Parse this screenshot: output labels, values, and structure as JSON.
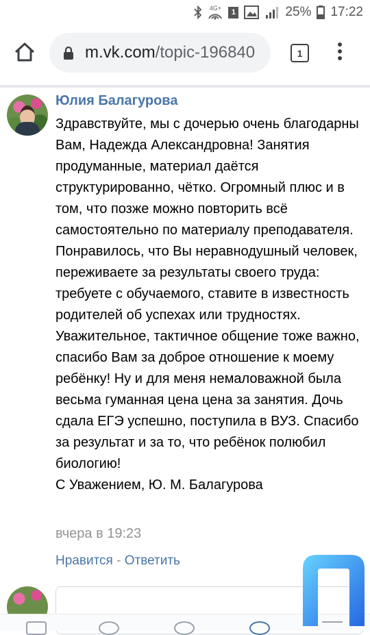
{
  "status_bar": {
    "network_label": "4G+",
    "sim_number": "1",
    "battery_percent": "25%",
    "time": "17:22"
  },
  "browser": {
    "url_domain": "m.vk.com",
    "url_path": "/topic-196840",
    "tab_count": "1"
  },
  "comment": {
    "author": "Юлия Балагурова",
    "text": "Здравствуйте, мы с дочерью очень благодарны Вам, Надежда Александровна! Занятия продуманные, материал даётся структурированно, чётко. Огромный плюс и в том, что позже можно повторить всё самостоятельно по материалу преподавателя. Понравилось, что Вы неравнодушный человек, переживаете за результаты своего труда: требуете с обучаемого, ставите в известность родителей об успехах или трудностях. Уважительное, тактичное общение тоже важно, спасибо Вам за доброе отношение к моему ребёнку! Ну и для меня немаловажной была весьма гуманная цена цена за занятия. Дочь сдала ЕГЭ успешно, поступила в ВУЗ. Спасибо за результат и за то, что ребёнок полюбил биологию!\nС Уважением, Ю. М. Балагурова",
    "time": "вчера в 19:23",
    "like_label": "Нравится",
    "separator": " - ",
    "reply_label": "Ответить"
  },
  "colors": {
    "link": "#4a76a8",
    "muted": "#939393",
    "watermark_gradient": [
      "#1a5fe0",
      "#5fd0ff"
    ]
  }
}
